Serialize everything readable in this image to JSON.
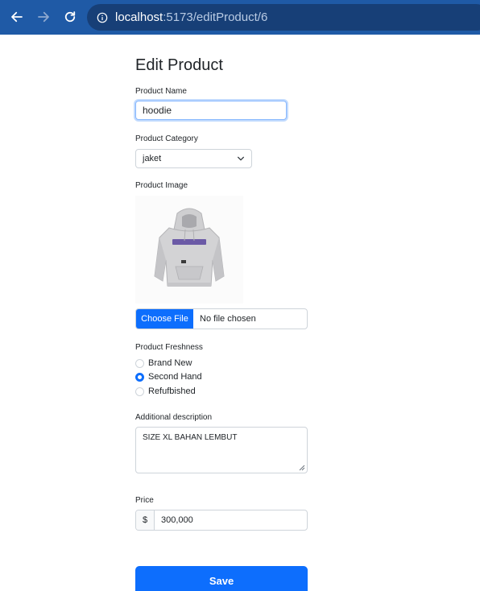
{
  "browser": {
    "url_host": "localhost",
    "url_path": ":5173/editProduct/6"
  },
  "form": {
    "title": "Edit Product",
    "product_name": {
      "label": "Product Name",
      "value": "hoodie"
    },
    "product_category": {
      "label": "Product Category",
      "selected": "jaket"
    },
    "product_image": {
      "label": "Product Image",
      "choose_file_label": "Choose File",
      "file_status": "No file chosen"
    },
    "freshness": {
      "label": "Product Freshness",
      "options": [
        {
          "label": "Brand New",
          "checked": false
        },
        {
          "label": "Second Hand",
          "checked": true
        },
        {
          "label": "Refufbished",
          "checked": false
        }
      ]
    },
    "description": {
      "label": "Additional description",
      "value": "SIZE XL BAHAN LEMBUT"
    },
    "price": {
      "label": "Price",
      "prefix": "$",
      "value": "300,000"
    },
    "save_label": "Save"
  },
  "colors": {
    "browser_bar": "#1f5aa6",
    "primary": "#0d6efd"
  }
}
